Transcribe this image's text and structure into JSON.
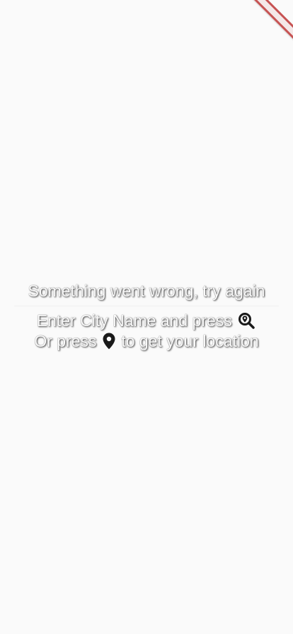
{
  "message": {
    "error": "Something went wrong, try again",
    "hint_line1_prefix": "Enter City Name and press",
    "hint_line2_prefix": "Or press",
    "hint_line2_suffix": "to get your location"
  },
  "icons": {
    "search": "search-location-icon",
    "location": "map-marker-icon"
  },
  "colors": {
    "background": "#fafafa",
    "text": "#fafafa",
    "text_shadow": "#000000",
    "debug_banner": "#b71c1c"
  }
}
